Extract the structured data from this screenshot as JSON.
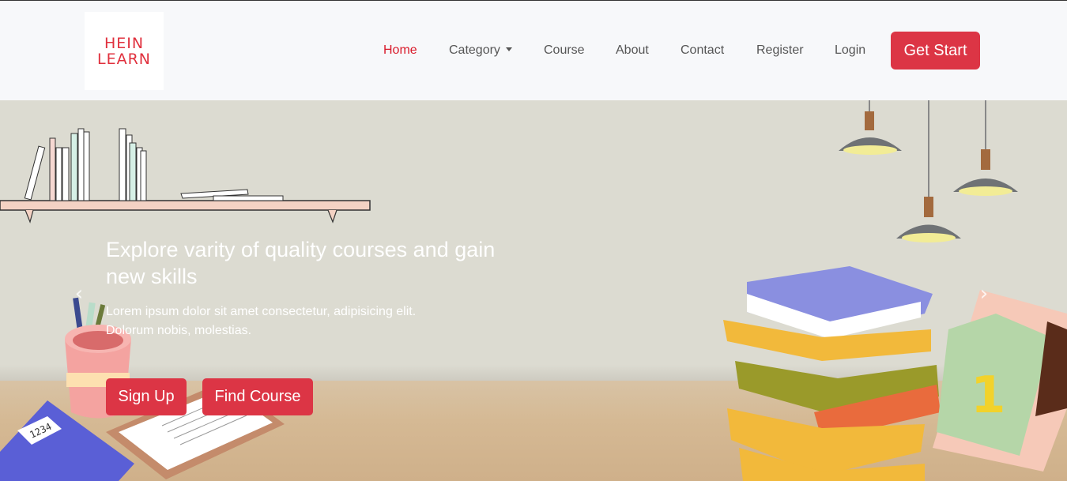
{
  "brand": {
    "logo_line1": "HEIN",
    "logo_line2": "LEARN",
    "accent": "#dc3545"
  },
  "nav": {
    "items": [
      {
        "label": "Home",
        "active": true
      },
      {
        "label": "Category",
        "dropdown": true
      },
      {
        "label": "Course"
      },
      {
        "label": "About"
      },
      {
        "label": "Contact"
      },
      {
        "label": "Register"
      },
      {
        "label": "Login"
      }
    ],
    "cta": "Get Start"
  },
  "hero": {
    "title": "Explore varity of quality courses and gain new skills",
    "text": "Lorem ipsum dolor sit amet consectetur, adipisicing elit. Dolorum nobis, molestias.",
    "buttons": {
      "signup": "Sign Up",
      "find": "Find Course"
    },
    "prev_icon": "chevron-left-icon",
    "next_icon": "chevron-right-icon"
  },
  "calculator_display": "1234",
  "calendar_day": "1"
}
